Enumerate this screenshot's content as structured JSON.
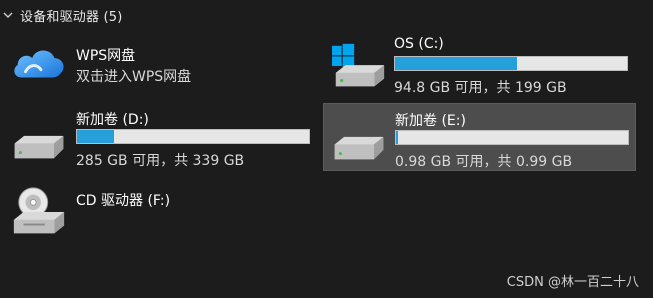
{
  "group": {
    "title": "设备和驱动器 (5)"
  },
  "items": {
    "wps": {
      "name": "WPS网盘",
      "subtitle": "双击进入WPS网盘"
    },
    "os": {
      "name": "OS (C:)",
      "space": "94.8 GB 可用，共 199 GB",
      "used_fraction": 0.524
    },
    "d": {
      "name": "新加卷 (D:)",
      "space": "285 GB 可用，共 339 GB",
      "used_fraction": 0.16
    },
    "e": {
      "name": "新加卷 (E:)",
      "space": "0.98 GB 可用，共 0.99 GB",
      "used_fraction": 0.01,
      "selected": true
    },
    "f": {
      "name": "CD 驱动器 (F:)"
    }
  },
  "watermark": "CSDN @林一百二十八",
  "colors": {
    "background": "#1c1c1c",
    "bar_fill": "#26a0da",
    "bar_track": "#e6e6e6",
    "selection": "#4d4d4d"
  },
  "icons": {
    "group_toggle": "chevron-down-icon",
    "wps": "cloud-icon",
    "os": "windows-drive-icon",
    "d": "drive-icon",
    "e": "drive-icon",
    "f": "cd-drive-icon"
  }
}
